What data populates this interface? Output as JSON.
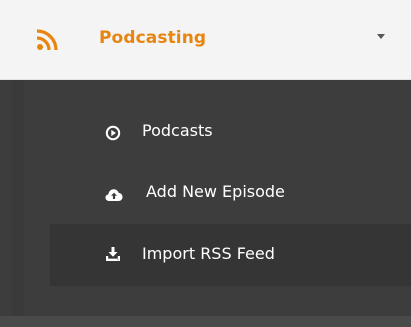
{
  "header": {
    "title": "Podcasting",
    "icon": "rss-icon",
    "accent_color": "#e8850f",
    "dropdown_icon": "caret-down-icon"
  },
  "menu": {
    "items": [
      {
        "label": "Podcasts",
        "icon": "play-circle-icon",
        "active": false
      },
      {
        "label": "Add New Episode",
        "icon": "cloud-upload-icon",
        "active": false
      },
      {
        "label": "Import RSS Feed",
        "icon": "download-icon",
        "active": true
      }
    ]
  }
}
